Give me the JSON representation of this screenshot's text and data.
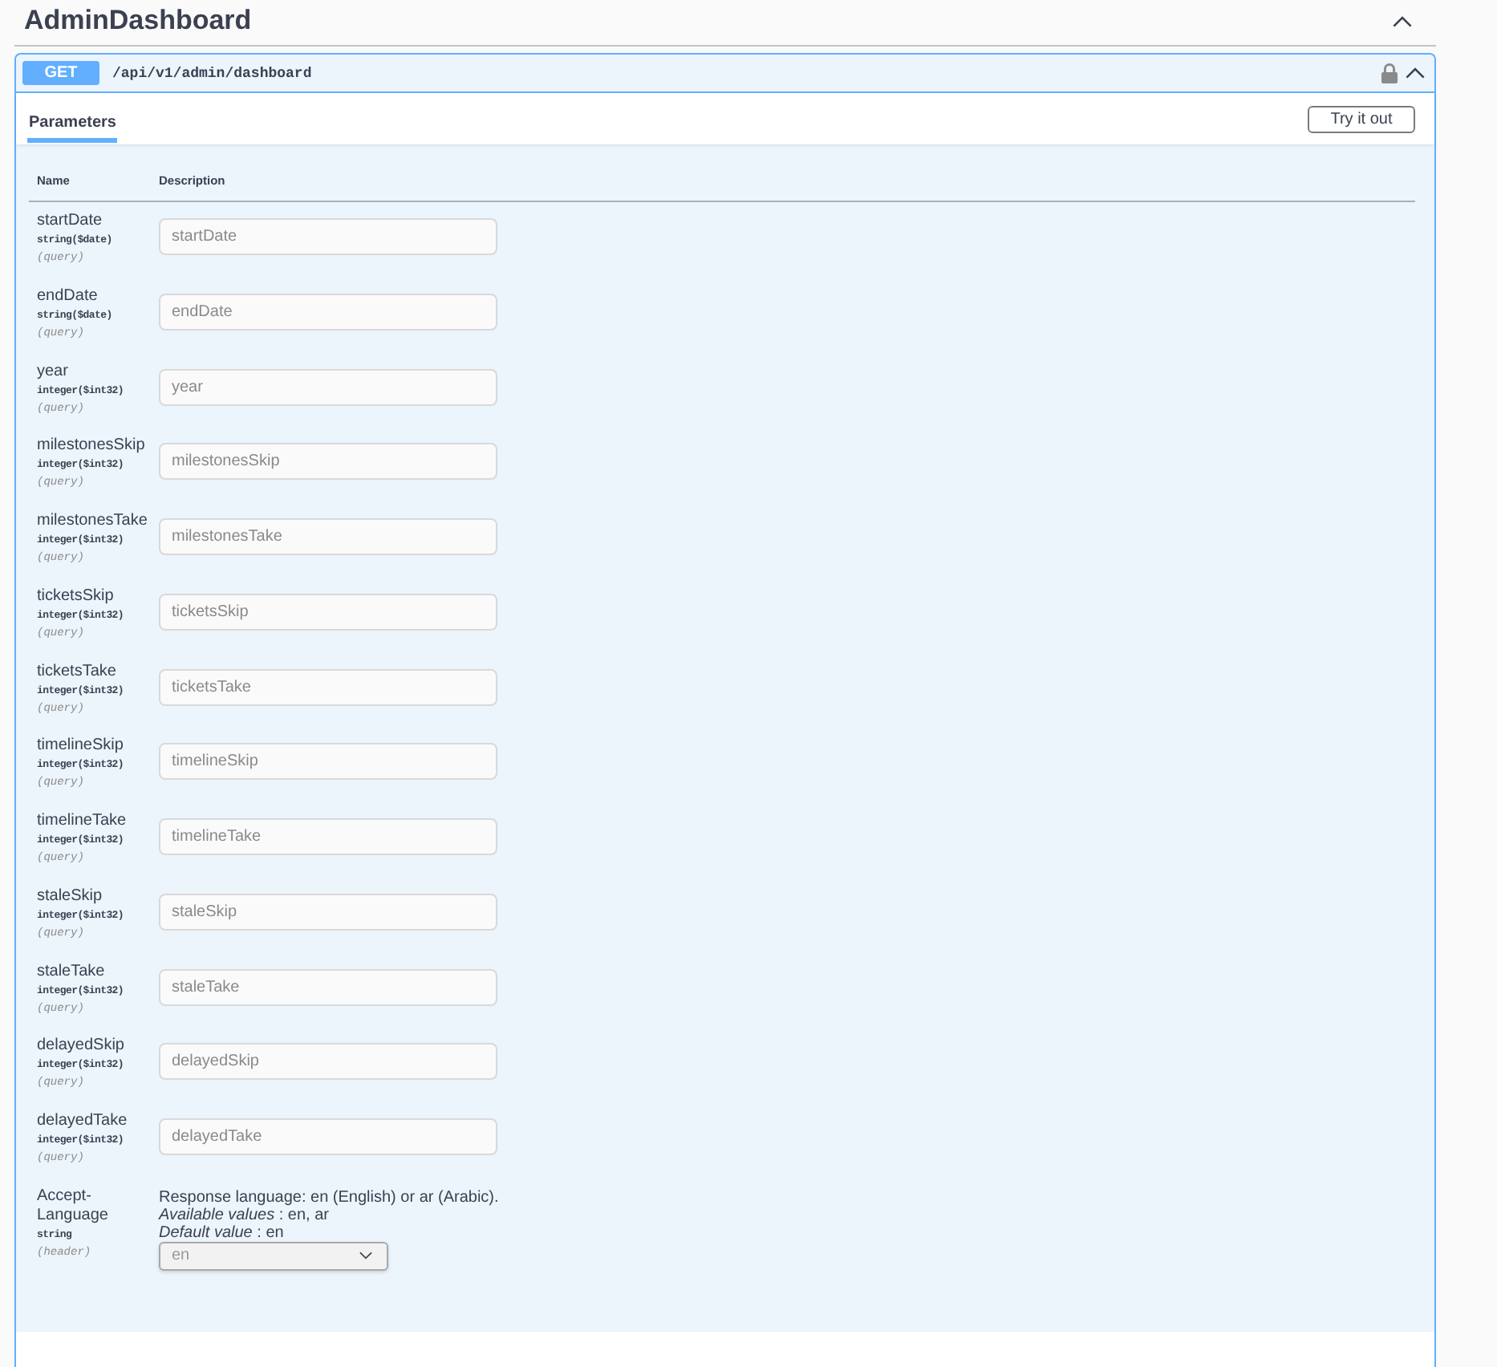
{
  "section": {
    "title": "AdminDashboard",
    "expanded": true
  },
  "operation": {
    "method": "GET",
    "path": "/api/v1/admin/dashboard",
    "locked": true,
    "expanded": true,
    "tabs": [
      {
        "label": "Parameters",
        "selected": true
      }
    ],
    "try_button": "Try it out",
    "parameters": {
      "columns": [
        "Name",
        "Description"
      ],
      "rows": [
        {
          "kind": "input",
          "name": "startDate",
          "type": "string($date)",
          "location": "(query)",
          "placeholder": "startDate"
        },
        {
          "kind": "input",
          "name": "endDate",
          "type": "string($date)",
          "location": "(query)",
          "placeholder": "endDate"
        },
        {
          "kind": "input",
          "name": "year",
          "type": "integer($int32)",
          "location": "(query)",
          "placeholder": "year"
        },
        {
          "kind": "input",
          "name": "milestonesSkip",
          "type": "integer($int32)",
          "location": "(query)",
          "placeholder": "milestonesSkip"
        },
        {
          "kind": "input",
          "name": "milestonesTake",
          "type": "integer($int32)",
          "location": "(query)",
          "placeholder": "milestonesTake"
        },
        {
          "kind": "input",
          "name": "ticketsSkip",
          "type": "integer($int32)",
          "location": "(query)",
          "placeholder": "ticketsSkip"
        },
        {
          "kind": "input",
          "name": "ticketsTake",
          "type": "integer($int32)",
          "location": "(query)",
          "placeholder": "ticketsTake"
        },
        {
          "kind": "input",
          "name": "timelineSkip",
          "type": "integer($int32)",
          "location": "(query)",
          "placeholder": "timelineSkip"
        },
        {
          "kind": "input",
          "name": "timelineTake",
          "type": "integer($int32)",
          "location": "(query)",
          "placeholder": "timelineTake"
        },
        {
          "kind": "input",
          "name": "staleSkip",
          "type": "integer($int32)",
          "location": "(query)",
          "placeholder": "staleSkip"
        },
        {
          "kind": "input",
          "name": "staleTake",
          "type": "integer($int32)",
          "location": "(query)",
          "placeholder": "staleTake"
        },
        {
          "kind": "input",
          "name": "delayedSkip",
          "type": "integer($int32)",
          "location": "(query)",
          "placeholder": "delayedSkip"
        },
        {
          "kind": "input",
          "name": "delayedTake",
          "type": "integer($int32)",
          "location": "(query)",
          "placeholder": "delayedTake"
        },
        {
          "kind": "select",
          "name": "Accept-Language",
          "type": "string",
          "location": "(header)",
          "description": "Response language: en (English) or ar (Arabic).",
          "available_values": "*Available values* : en, ar",
          "default_value": "*Default value* : en",
          "value": "en",
          "disabled": true
        }
      ]
    }
  }
}
